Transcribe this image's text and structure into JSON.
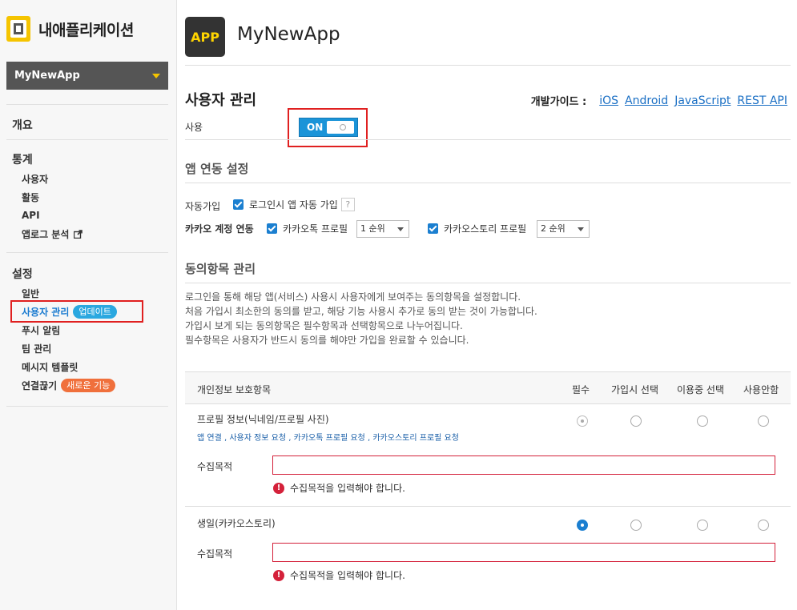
{
  "sidebar": {
    "title": "내애플리케이션",
    "app_selector": "MyNewApp",
    "overview": "개요",
    "stats": {
      "title": "통계",
      "items": [
        "사용자",
        "활동",
        "API",
        "앱로그 분석"
      ]
    },
    "settings": {
      "title": "설정",
      "items": [
        "일반",
        "사용자 관리",
        "푸시 알림",
        "팀 관리",
        "메시지 템플릿",
        "연결끊기"
      ],
      "badge_update": "업데이트",
      "badge_new": "새로운 기능"
    }
  },
  "header": {
    "app_badge": "APP",
    "app_name": "MyNewApp"
  },
  "user_mgmt": {
    "title": "사용자 관리",
    "guide_label": "개발가이드 :",
    "guide_links": [
      "iOS",
      "Android",
      "JavaScript",
      "REST API"
    ],
    "use_label": "사용",
    "toggle": "ON"
  },
  "link_settings": {
    "title": "앱 연동 설정",
    "auto_join_label": "자동가입",
    "auto_join_option": "로그인시 앱 자동 가입",
    "help": "?",
    "kakao_label": "카카오 계정 연동",
    "talk_profile": "카카오톡 프로필",
    "talk_rank": "1 순위",
    "story_profile": "카카오스토리 프로필",
    "story_rank": "2 순위"
  },
  "consent": {
    "title": "동의항목 관리",
    "desc": [
      "로그인을 통해 해당 앱(서비스) 사용시 사용자에게 보여주는 동의항목을 설정합니다.",
      "처음 가입시 최소한의 동의를 받고, 해당 기능 사용시 추가로 동의 받는 것이 가능합니다.",
      "가입시 보게 되는 동의항목은 필수항목과 선택항목으로 나누어집니다.",
      "필수항목은 사용자가 반드시 동의를 해야만 가입을 완료할 수 있습니다."
    ],
    "columns": [
      "개인정보 보호항목",
      "필수",
      "가입시 선택",
      "이용중 선택",
      "사용안함"
    ],
    "rows": [
      {
        "name": "프로필 정보(닉네임/프로필 사진)",
        "links": [
          "앱 연결",
          "사용자 정보 요청",
          "카카오톡 프로필 요청",
          "카카오스토리 프로필 요청"
        ],
        "purpose_label": "수집목적",
        "error": "수집목적을 입력해야 합니다."
      },
      {
        "name": "생일(카카오스토리)",
        "purpose_label": "수집목적",
        "error": "수집목적을 입력해야 합니다."
      }
    ]
  }
}
